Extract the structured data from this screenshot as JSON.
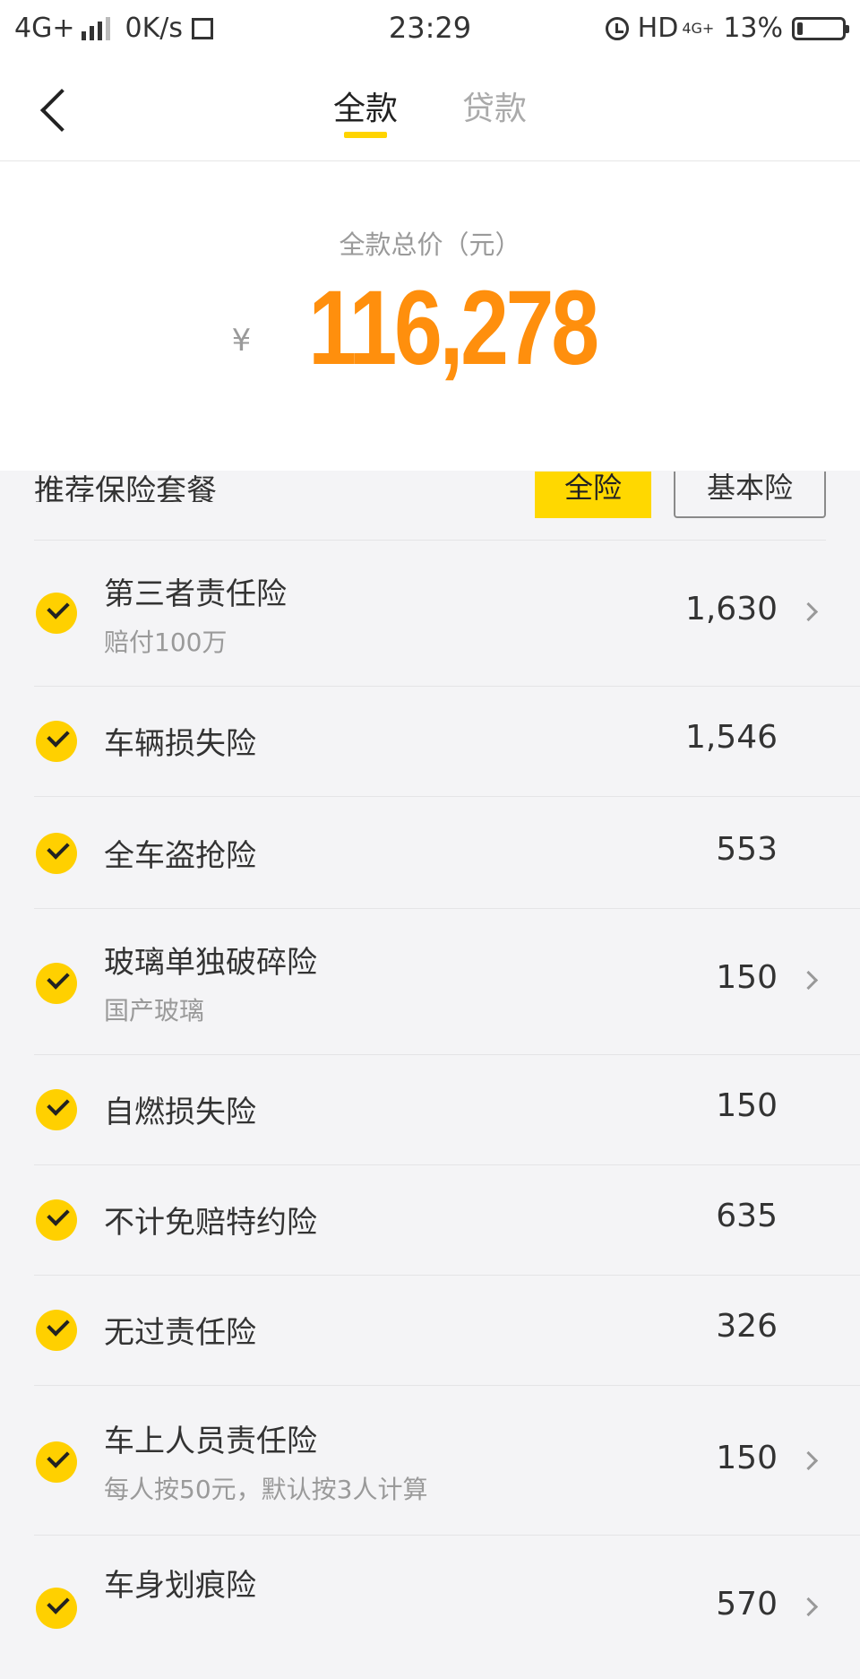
{
  "status_bar": {
    "network": "4G+",
    "speed": "0K/s",
    "time": "23:29",
    "hd": "HD",
    "net_type": "4G+",
    "battery": "13%"
  },
  "nav": {
    "tabs": [
      {
        "label": "全款",
        "active": true
      },
      {
        "label": "贷款",
        "active": false
      }
    ]
  },
  "price": {
    "label": "全款总价（元）",
    "currency": "¥",
    "value": "116,278"
  },
  "insurance": {
    "title": "推荐保险套餐",
    "plans": [
      "全险",
      "基本险"
    ],
    "items": [
      {
        "name": "第三者责任险",
        "sub": "赔付100万",
        "price": "1,630",
        "chevron": true
      },
      {
        "name": "车辆损失险",
        "sub": "",
        "price": "1,546",
        "chevron": false
      },
      {
        "name": "全车盗抢险",
        "sub": "",
        "price": "553",
        "chevron": false
      },
      {
        "name": "玻璃单独破碎险",
        "sub": "国产玻璃",
        "price": "150",
        "chevron": true
      },
      {
        "name": "自燃损失险",
        "sub": "",
        "price": "150",
        "chevron": false
      },
      {
        "name": "不计免赔特约险",
        "sub": "",
        "price": "635",
        "chevron": false
      },
      {
        "name": "无过责任险",
        "sub": "",
        "price": "326",
        "chevron": false
      },
      {
        "name": "车上人员责任险",
        "sub": "每人按50元，默认按3人计算",
        "price": "150",
        "chevron": true
      },
      {
        "name": "车身划痕险",
        "sub": "",
        "price": "570",
        "chevron": true
      }
    ]
  }
}
